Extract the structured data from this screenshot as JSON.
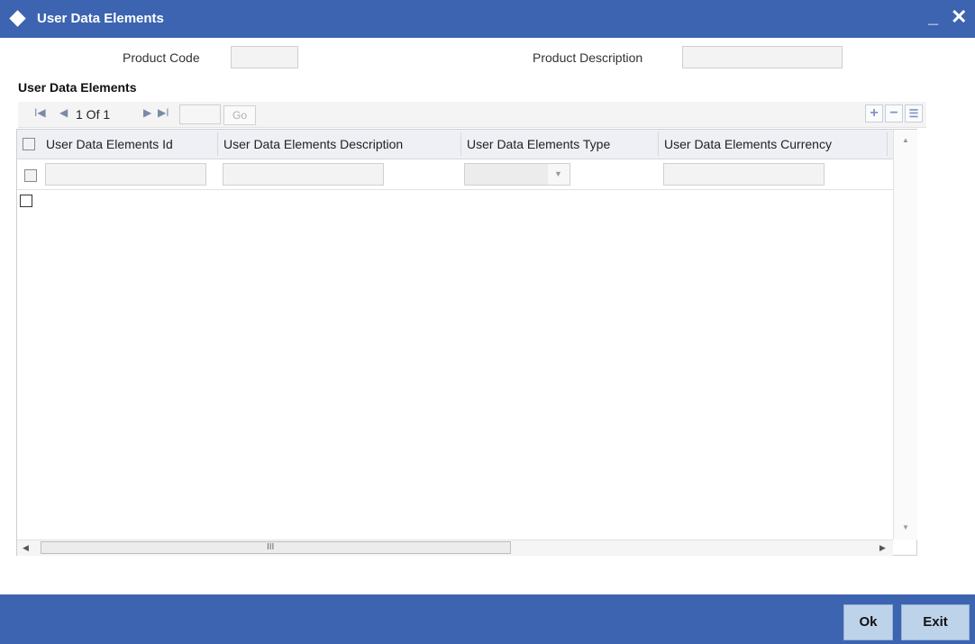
{
  "window": {
    "title": "User Data Elements",
    "minimize_glyph": "_",
    "close_glyph": "✕"
  },
  "header": {
    "product_code_label": "Product Code",
    "product_code_value": "",
    "product_description_label": "Product Description",
    "product_description_value": ""
  },
  "section": {
    "title": "User Data Elements"
  },
  "pager": {
    "first_glyph": "I◀",
    "prev_glyph": "◀",
    "page_text": "1 Of 1",
    "next_glyph": "▶",
    "last_glyph": "▶I",
    "go_label": "Go",
    "page_input_value": ""
  },
  "toolbar": {
    "add_glyph": "+",
    "delete_glyph": "−",
    "view_glyph": "☰"
  },
  "grid": {
    "columns": [
      "User Data Elements Id",
      "User Data Elements Description",
      "User Data Elements Type",
      "User Data Elements Currency"
    ],
    "rows": [
      {
        "id": "",
        "description": "",
        "type": "",
        "currency": ""
      }
    ],
    "hscroll_grip": "III"
  },
  "footer": {
    "ok_label": "Ok",
    "exit_label": "Exit"
  },
  "colors": {
    "title_bar": "#3c64b0",
    "footer_bar": "#3c64b0",
    "button_bg": "#bdd3ea",
    "grid_header_bg": "#eef0f5"
  }
}
